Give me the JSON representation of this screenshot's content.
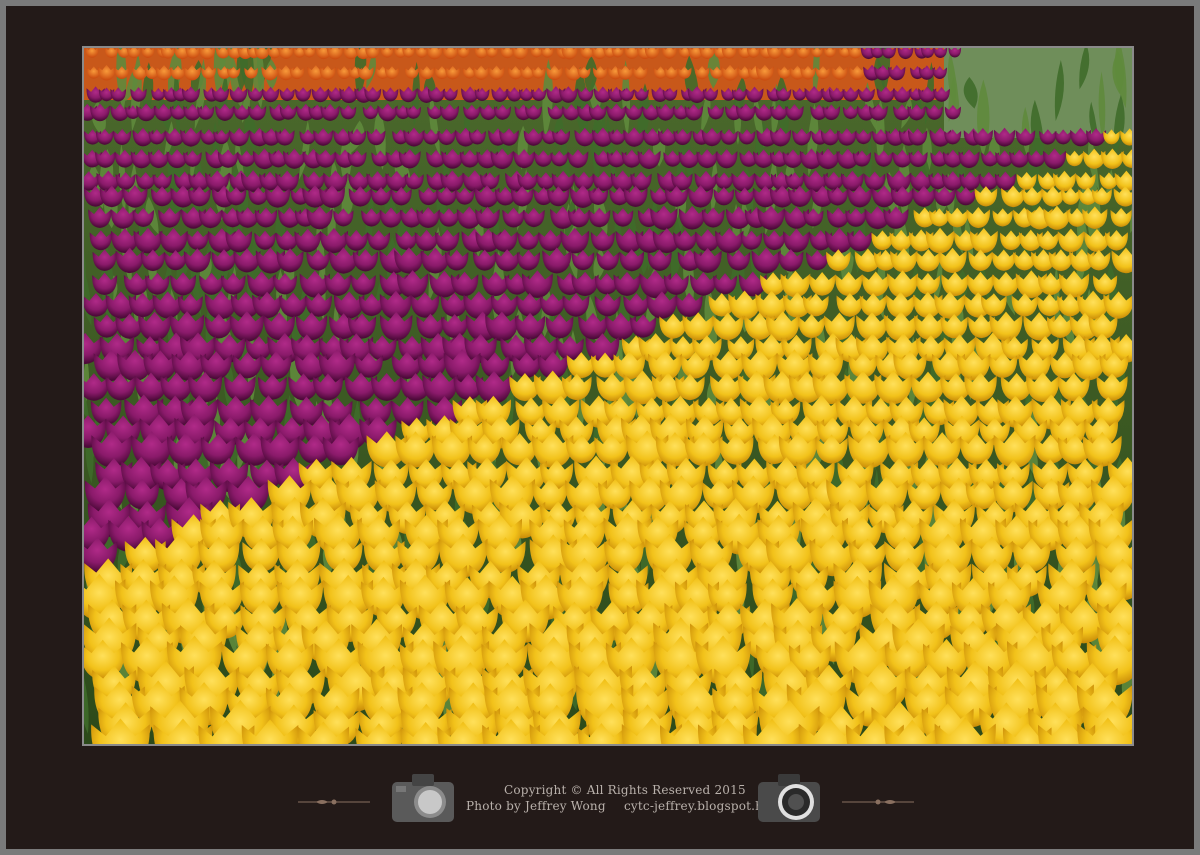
{
  "photo": {
    "subject": "tulip-field",
    "colors": {
      "orange": "#e0641a",
      "purple": "#8a1a6a",
      "deep_purple": "#6a1050",
      "yellow": "#f2c21a",
      "yellow_dark": "#d89a10",
      "leaf": "#3f6b2a",
      "leaf_light": "#6f9a4a"
    }
  },
  "footer": {
    "copyright": "Copyright © All Rights Reserved 2015",
    "author": "Photo by Jeffrey Wong",
    "blog": "cytc-jeffrey.blogspot.hk",
    "left_icon": "camera-icon",
    "right_icon": "camera-icon"
  },
  "colors": {
    "frame_bg": "#231a18",
    "frame_border": "#7a7a7a",
    "text": "#b9b1ab"
  }
}
